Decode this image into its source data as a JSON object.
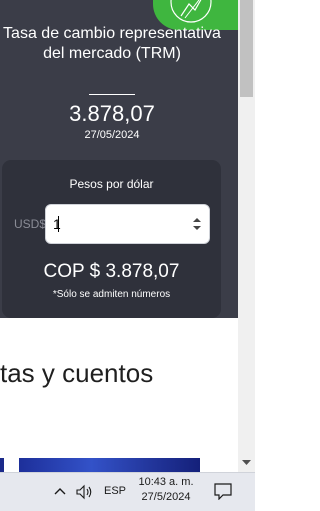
{
  "trm": {
    "title": "Tasa de cambio representativa del mercado (TRM)",
    "value": "3.878,07",
    "date": "27/05/2024"
  },
  "converter": {
    "label": "Pesos por dólar",
    "currency_prefix": "USD$",
    "input_value": "1",
    "result": "COP $ 3.878,07",
    "note": "*Sólo se admiten números"
  },
  "content": {
    "section_heading": "tas y cuentos"
  },
  "taskbar": {
    "language": "ESP",
    "time": "10:43 a. m.",
    "date": "27/5/2024"
  },
  "colors": {
    "card_background": "#3b3d48",
    "converter_background": "#2f313b",
    "logo_green": "#3fb63f"
  },
  "icons": [
    "logo-icon",
    "spin-up-icon",
    "spin-down-icon",
    "scroll-down-icon",
    "chevron-up-icon",
    "volume-icon",
    "notifications-icon"
  ]
}
